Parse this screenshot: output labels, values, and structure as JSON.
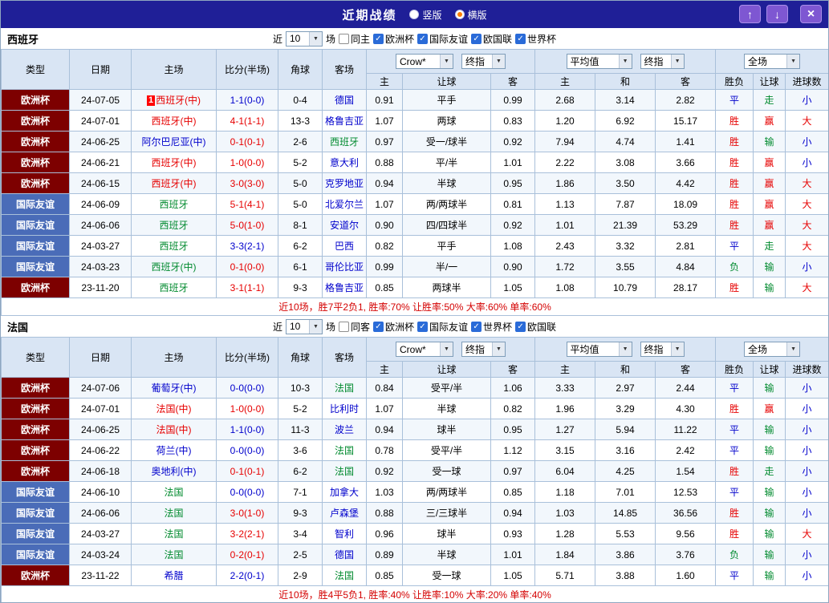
{
  "colors": {
    "titlebar_bg": "#1f1f97",
    "button_bg": "#7e57d2",
    "button_border": "#a98ee8",
    "header_bg": "#d9e5f4",
    "border": "#a9c0da",
    "row_alt": "#f2f7fc",
    "euro_bg": "#7d0000",
    "friendly_bg": "#4a6cb8",
    "red": "#e60000",
    "green": "#008a2e",
    "blue": "#0000cc",
    "summary": "#d40000",
    "radio_dot": "#ff7e00",
    "checkbox": "#2a6bd8",
    "badge_bg": "#ff0000"
  },
  "titlebar": {
    "title": "近期战绩",
    "radios": [
      {
        "label": "竖版",
        "selected": false
      },
      {
        "label": "横版",
        "selected": true
      }
    ],
    "buttons": {
      "up": "↑",
      "down": "↓",
      "close": "×"
    }
  },
  "columns": {
    "type": "类型",
    "date": "日期",
    "home": "主场",
    "score": "比分(半场)",
    "corner": "角球",
    "away": "客场",
    "odds_home": "主",
    "odds_handicap": "让球",
    "odds_away": "客",
    "avg_home": "主",
    "avg_draw": "和",
    "avg_away": "客",
    "result_wdl": "胜负",
    "result_handicap": "让球",
    "result_goals": "进球数",
    "company_select": "Crow*",
    "final_select": "终指",
    "average_select": "平均值",
    "average_final_select": "终指",
    "fulltime_select": "全场"
  },
  "sections": [
    {
      "team": "西班牙",
      "filter": {
        "near": "近",
        "count": "10",
        "games": "场",
        "same": "同主",
        "same_checked": false,
        "leagues": [
          {
            "label": "欧洲杯",
            "checked": true
          },
          {
            "label": "国际友谊",
            "checked": true
          },
          {
            "label": "欧国联",
            "checked": true
          },
          {
            "label": "世界杯",
            "checked": true
          }
        ]
      },
      "rows": [
        {
          "type": "欧洲杯",
          "type_class": "euro",
          "date": "24-07-05",
          "badge": "1",
          "home": "西班牙(中)",
          "home_color": "red",
          "score": "1-1(0-0)",
          "score_color": "blue",
          "corner": "0-4",
          "away": "德国",
          "away_color": "blue",
          "odds_home": "0.91",
          "handicap": "平手",
          "odds_away": "0.99",
          "avg_home": "2.68",
          "avg_draw": "3.14",
          "avg_away": "2.82",
          "res_wdl": "平",
          "res_wdl_color": "blue",
          "res_let": "走",
          "res_let_color": "green",
          "res_goal": "小",
          "res_goal_color": "blue"
        },
        {
          "type": "欧洲杯",
          "type_class": "euro",
          "date": "24-07-01",
          "home": "西班牙(中)",
          "home_color": "red",
          "score": "4-1(1-1)",
          "score_color": "red",
          "corner": "13-3",
          "away": "格鲁吉亚",
          "away_color": "blue",
          "odds_home": "1.07",
          "handicap": "两球",
          "odds_away": "0.83",
          "avg_home": "1.20",
          "avg_draw": "6.92",
          "avg_away": "15.17",
          "res_wdl": "胜",
          "res_wdl_color": "red",
          "res_let": "赢",
          "res_let_color": "red",
          "res_goal": "大",
          "res_goal_color": "red"
        },
        {
          "type": "欧洲杯",
          "type_class": "euro",
          "date": "24-06-25",
          "home": "阿尔巴尼亚(中)",
          "home_color": "blue",
          "score": "0-1(0-1)",
          "score_color": "red",
          "corner": "2-6",
          "away": "西班牙",
          "away_color": "green",
          "odds_home": "0.97",
          "handicap": "受一/球半",
          "odds_away": "0.92",
          "avg_home": "7.94",
          "avg_draw": "4.74",
          "avg_away": "1.41",
          "res_wdl": "胜",
          "res_wdl_color": "red",
          "res_let": "输",
          "res_let_color": "green",
          "res_goal": "小",
          "res_goal_color": "blue"
        },
        {
          "type": "欧洲杯",
          "type_class": "euro",
          "date": "24-06-21",
          "home": "西班牙(中)",
          "home_color": "red",
          "score": "1-0(0-0)",
          "score_color": "red",
          "corner": "5-2",
          "away": "意大利",
          "away_color": "blue",
          "odds_home": "0.88",
          "handicap": "平/半",
          "odds_away": "1.01",
          "avg_home": "2.22",
          "avg_draw": "3.08",
          "avg_away": "3.66",
          "res_wdl": "胜",
          "res_wdl_color": "red",
          "res_let": "赢",
          "res_let_color": "red",
          "res_goal": "小",
          "res_goal_color": "blue"
        },
        {
          "type": "欧洲杯",
          "type_class": "euro",
          "date": "24-06-15",
          "home": "西班牙(中)",
          "home_color": "red",
          "score": "3-0(3-0)",
          "score_color": "red",
          "corner": "5-0",
          "away": "克罗地亚",
          "away_color": "blue",
          "odds_home": "0.94",
          "handicap": "半球",
          "odds_away": "0.95",
          "avg_home": "1.86",
          "avg_draw": "3.50",
          "avg_away": "4.42",
          "res_wdl": "胜",
          "res_wdl_color": "red",
          "res_let": "赢",
          "res_let_color": "red",
          "res_goal": "大",
          "res_goal_color": "red"
        },
        {
          "type": "国际友谊",
          "type_class": "friendly",
          "date": "24-06-09",
          "home": "西班牙",
          "home_color": "green",
          "score": "5-1(4-1)",
          "score_color": "red",
          "corner": "5-0",
          "away": "北爱尔兰",
          "away_color": "blue",
          "odds_home": "1.07",
          "handicap": "两/两球半",
          "odds_away": "0.81",
          "avg_home": "1.13",
          "avg_draw": "7.87",
          "avg_away": "18.09",
          "res_wdl": "胜",
          "res_wdl_color": "red",
          "res_let": "赢",
          "res_let_color": "red",
          "res_goal": "大",
          "res_goal_color": "red"
        },
        {
          "type": "国际友谊",
          "type_class": "friendly",
          "date": "24-06-06",
          "home": "西班牙",
          "home_color": "green",
          "score": "5-0(1-0)",
          "score_color": "red",
          "corner": "8-1",
          "away": "安道尔",
          "away_color": "blue",
          "odds_home": "0.90",
          "handicap": "四/四球半",
          "odds_away": "0.92",
          "avg_home": "1.01",
          "avg_draw": "21.39",
          "avg_away": "53.29",
          "res_wdl": "胜",
          "res_wdl_color": "red",
          "res_let": "赢",
          "res_let_color": "red",
          "res_goal": "大",
          "res_goal_color": "red"
        },
        {
          "type": "国际友谊",
          "type_class": "friendly",
          "date": "24-03-27",
          "home": "西班牙",
          "home_color": "green",
          "score": "3-3(2-1)",
          "score_color": "blue",
          "corner": "6-2",
          "away": "巴西",
          "away_color": "blue",
          "odds_home": "0.82",
          "handicap": "平手",
          "odds_away": "1.08",
          "avg_home": "2.43",
          "avg_draw": "3.32",
          "avg_away": "2.81",
          "res_wdl": "平",
          "res_wdl_color": "blue",
          "res_let": "走",
          "res_let_color": "green",
          "res_goal": "大",
          "res_goal_color": "red"
        },
        {
          "type": "国际友谊",
          "type_class": "friendly",
          "date": "24-03-23",
          "home": "西班牙(中)",
          "home_color": "green",
          "score": "0-1(0-0)",
          "score_color": "red",
          "corner": "6-1",
          "away": "哥伦比亚",
          "away_color": "blue",
          "odds_home": "0.99",
          "handicap": "半/一",
          "odds_away": "0.90",
          "avg_home": "1.72",
          "avg_draw": "3.55",
          "avg_away": "4.84",
          "res_wdl": "负",
          "res_wdl_color": "green",
          "res_let": "输",
          "res_let_color": "green",
          "res_goal": "小",
          "res_goal_color": "blue"
        },
        {
          "type": "欧洲杯",
          "type_class": "euro",
          "date": "23-11-20",
          "home": "西班牙",
          "home_color": "green",
          "score": "3-1(1-1)",
          "score_color": "red",
          "corner": "9-3",
          "away": "格鲁吉亚",
          "away_color": "blue",
          "odds_home": "0.85",
          "handicap": "两球半",
          "odds_away": "1.05",
          "avg_home": "1.08",
          "avg_draw": "10.79",
          "avg_away": "28.17",
          "res_wdl": "胜",
          "res_wdl_color": "red",
          "res_let": "输",
          "res_let_color": "green",
          "res_goal": "大",
          "res_goal_color": "red"
        }
      ],
      "summary": "近10场，胜7平2负1, 胜率:70% 让胜率:50% 大率:60% 单率:60%"
    },
    {
      "team": "法国",
      "filter": {
        "near": "近",
        "count": "10",
        "games": "场",
        "same": "同客",
        "same_checked": false,
        "leagues": [
          {
            "label": "欧洲杯",
            "checked": true
          },
          {
            "label": "国际友谊",
            "checked": true
          },
          {
            "label": "世界杯",
            "checked": true
          },
          {
            "label": "欧国联",
            "checked": true
          }
        ]
      },
      "rows": [
        {
          "type": "欧洲杯",
          "type_class": "euro",
          "date": "24-07-06",
          "home": "葡萄牙(中)",
          "home_color": "blue",
          "score": "0-0(0-0)",
          "score_color": "blue",
          "corner": "10-3",
          "away": "法国",
          "away_color": "green",
          "odds_home": "0.84",
          "handicap": "受平/半",
          "odds_away": "1.06",
          "avg_home": "3.33",
          "avg_draw": "2.97",
          "avg_away": "2.44",
          "res_wdl": "平",
          "res_wdl_color": "blue",
          "res_let": "输",
          "res_let_color": "green",
          "res_goal": "小",
          "res_goal_color": "blue"
        },
        {
          "type": "欧洲杯",
          "type_class": "euro",
          "date": "24-07-01",
          "home": "法国(中)",
          "home_color": "red",
          "score": "1-0(0-0)",
          "score_color": "red",
          "corner": "5-2",
          "away": "比利时",
          "away_color": "blue",
          "odds_home": "1.07",
          "handicap": "半球",
          "odds_away": "0.82",
          "avg_home": "1.96",
          "avg_draw": "3.29",
          "avg_away": "4.30",
          "res_wdl": "胜",
          "res_wdl_color": "red",
          "res_let": "赢",
          "res_let_color": "red",
          "res_goal": "小",
          "res_goal_color": "blue"
        },
        {
          "type": "欧洲杯",
          "type_class": "euro",
          "date": "24-06-25",
          "home": "法国(中)",
          "home_color": "red",
          "score": "1-1(0-0)",
          "score_color": "blue",
          "corner": "11-3",
          "away": "波兰",
          "away_color": "blue",
          "odds_home": "0.94",
          "handicap": "球半",
          "odds_away": "0.95",
          "avg_home": "1.27",
          "avg_draw": "5.94",
          "avg_away": "11.22",
          "res_wdl": "平",
          "res_wdl_color": "blue",
          "res_let": "输",
          "res_let_color": "green",
          "res_goal": "小",
          "res_goal_color": "blue"
        },
        {
          "type": "欧洲杯",
          "type_class": "euro",
          "date": "24-06-22",
          "home": "荷兰(中)",
          "home_color": "blue",
          "score": "0-0(0-0)",
          "score_color": "blue",
          "corner": "3-6",
          "away": "法国",
          "away_color": "green",
          "odds_home": "0.78",
          "handicap": "受平/半",
          "odds_away": "1.12",
          "avg_home": "3.15",
          "avg_draw": "3.16",
          "avg_away": "2.42",
          "res_wdl": "平",
          "res_wdl_color": "blue",
          "res_let": "输",
          "res_let_color": "green",
          "res_goal": "小",
          "res_goal_color": "blue"
        },
        {
          "type": "欧洲杯",
          "type_class": "euro",
          "date": "24-06-18",
          "home": "奥地利(中)",
          "home_color": "blue",
          "score": "0-1(0-1)",
          "score_color": "red",
          "corner": "6-2",
          "away": "法国",
          "away_color": "green",
          "odds_home": "0.92",
          "handicap": "受一球",
          "odds_away": "0.97",
          "avg_home": "6.04",
          "avg_draw": "4.25",
          "avg_away": "1.54",
          "res_wdl": "胜",
          "res_wdl_color": "red",
          "res_let": "走",
          "res_let_color": "green",
          "res_goal": "小",
          "res_goal_color": "blue"
        },
        {
          "type": "国际友谊",
          "type_class": "friendly",
          "date": "24-06-10",
          "home": "法国",
          "home_color": "green",
          "score": "0-0(0-0)",
          "score_color": "blue",
          "corner": "7-1",
          "away": "加拿大",
          "away_color": "blue",
          "odds_home": "1.03",
          "handicap": "两/两球半",
          "odds_away": "0.85",
          "avg_home": "1.18",
          "avg_draw": "7.01",
          "avg_away": "12.53",
          "res_wdl": "平",
          "res_wdl_color": "blue",
          "res_let": "输",
          "res_let_color": "green",
          "res_goal": "小",
          "res_goal_color": "blue"
        },
        {
          "type": "国际友谊",
          "type_class": "friendly",
          "date": "24-06-06",
          "home": "法国",
          "home_color": "green",
          "score": "3-0(1-0)",
          "score_color": "red",
          "corner": "9-3",
          "away": "卢森堡",
          "away_color": "blue",
          "odds_home": "0.88",
          "handicap": "三/三球半",
          "odds_away": "0.94",
          "avg_home": "1.03",
          "avg_draw": "14.85",
          "avg_away": "36.56",
          "res_wdl": "胜",
          "res_wdl_color": "red",
          "res_let": "输",
          "res_let_color": "green",
          "res_goal": "小",
          "res_goal_color": "blue"
        },
        {
          "type": "国际友谊",
          "type_class": "friendly",
          "date": "24-03-27",
          "home": "法国",
          "home_color": "green",
          "score": "3-2(2-1)",
          "score_color": "red",
          "corner": "3-4",
          "away": "智利",
          "away_color": "blue",
          "odds_home": "0.96",
          "handicap": "球半",
          "odds_away": "0.93",
          "avg_home": "1.28",
          "avg_draw": "5.53",
          "avg_away": "9.56",
          "res_wdl": "胜",
          "res_wdl_color": "red",
          "res_let": "输",
          "res_let_color": "green",
          "res_goal": "大",
          "res_goal_color": "red"
        },
        {
          "type": "国际友谊",
          "type_class": "friendly",
          "date": "24-03-24",
          "home": "法国",
          "home_color": "green",
          "score": "0-2(0-1)",
          "score_color": "red",
          "corner": "2-5",
          "away": "德国",
          "away_color": "blue",
          "odds_home": "0.89",
          "handicap": "半球",
          "odds_away": "1.01",
          "avg_home": "1.84",
          "avg_draw": "3.86",
          "avg_away": "3.76",
          "res_wdl": "负",
          "res_wdl_color": "green",
          "res_let": "输",
          "res_let_color": "green",
          "res_goal": "小",
          "res_goal_color": "blue"
        },
        {
          "type": "欧洲杯",
          "type_class": "euro",
          "date": "23-11-22",
          "home": "希腊",
          "home_color": "blue",
          "score": "2-2(0-1)",
          "score_color": "blue",
          "corner": "2-9",
          "away": "法国",
          "away_color": "green",
          "odds_home": "0.85",
          "handicap": "受一球",
          "odds_away": "1.05",
          "avg_home": "5.71",
          "avg_draw": "3.88",
          "avg_away": "1.60",
          "res_wdl": "平",
          "res_wdl_color": "blue",
          "res_let": "输",
          "res_let_color": "green",
          "res_goal": "小",
          "res_goal_color": "blue"
        }
      ],
      "summary": "近10场，胜4平5负1, 胜率:40% 让胜率:10% 大率:20% 单率:40%"
    }
  ]
}
